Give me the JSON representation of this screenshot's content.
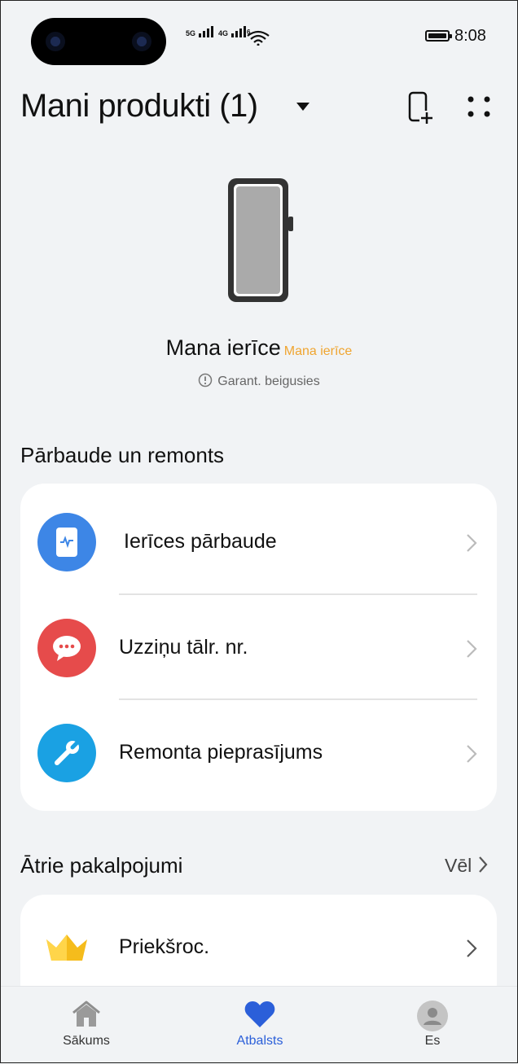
{
  "status_bar": {
    "signal_1": "5G",
    "signal_2": "4G",
    "wifi_badge": "6",
    "battery_level": 1.0,
    "time": "8:08"
  },
  "header": {
    "title": "Mani produkti (1)",
    "icons": [
      "dropdown-caret-icon",
      "add-device-icon",
      "more-icon"
    ]
  },
  "device": {
    "name": "Mana ierīce",
    "tag": "Mana ierīce",
    "warranty_status": "Garant. beigusies"
  },
  "check_repair": {
    "title": "Pārbaude un remonts",
    "items": [
      {
        "label": "Ierīces pārbaude",
        "icon": "phone-check-icon",
        "color": "#3d86e6"
      },
      {
        "label": "Uzziņu tālr. nr.",
        "icon": "chat-bubble-icon",
        "color": "#e64b4b"
      },
      {
        "label": "Remonta pieprasījums",
        "icon": "wrench-icon",
        "color": "#1aa1e3"
      }
    ]
  },
  "quick_services": {
    "title": "Ātrie pakalpojumi",
    "more_label": "Vēl",
    "items": [
      {
        "label": "Priekšroc.",
        "icon": "crown-icon",
        "color": "#f5bc1c"
      }
    ]
  },
  "bottom_nav": {
    "items": [
      {
        "label": "Sākums",
        "icon": "home-icon",
        "active": false
      },
      {
        "label": "Atbalsts",
        "icon": "heart-icon",
        "active": true
      },
      {
        "label": "Es",
        "icon": "avatar-icon",
        "active": false
      }
    ],
    "active_color": "#2b5fd9"
  }
}
